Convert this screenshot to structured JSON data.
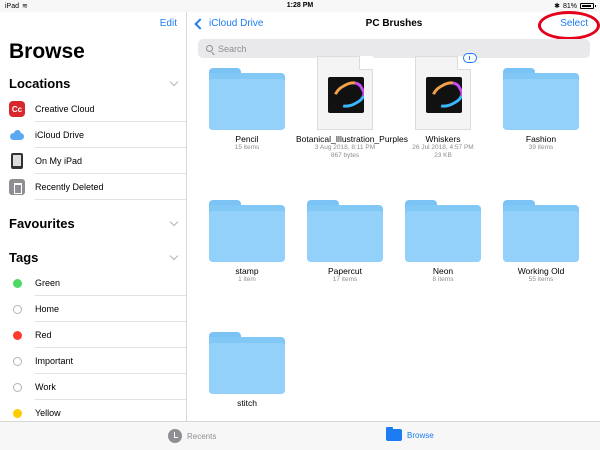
{
  "status": {
    "device": "iPad",
    "time": "1:28 PM",
    "battery": "81%"
  },
  "sidebar": {
    "edit_label": "Edit",
    "title": "Browse",
    "locations_header": "Locations",
    "locations": [
      {
        "label": "Creative Cloud",
        "icon": "creative-cloud-icon"
      },
      {
        "label": "iCloud Drive",
        "icon": "icloud-icon"
      },
      {
        "label": "On My iPad",
        "icon": "ipad-icon"
      },
      {
        "label": "Recently Deleted",
        "icon": "trash-icon"
      }
    ],
    "favourites_header": "Favourites",
    "tags_header": "Tags",
    "tags": [
      {
        "label": "Green",
        "color": "#4cd964"
      },
      {
        "label": "Home",
        "color": ""
      },
      {
        "label": "Red",
        "color": "#ff3b30"
      },
      {
        "label": "Important",
        "color": ""
      },
      {
        "label": "Work",
        "color": ""
      },
      {
        "label": "Yellow",
        "color": "#ffcc00"
      }
    ]
  },
  "nav": {
    "back_label": "iCloud Drive",
    "title": "PC Brushes",
    "select_label": "Select"
  },
  "search": {
    "placeholder": "Search"
  },
  "items": [
    {
      "type": "folder",
      "name": "Pencil",
      "meta1": "15 items",
      "meta2": ""
    },
    {
      "type": "doc",
      "name": "Botanical_Illustration_Purples",
      "meta1": "3 Aug 2018, 8:11 PM",
      "meta2": "867 bytes"
    },
    {
      "type": "doc",
      "name": "Whiskers",
      "meta1": "26 Jul 2018, 4:57 PM",
      "meta2": "23 KB"
    },
    {
      "type": "folder",
      "name": "Fashion",
      "meta1": "39 items",
      "meta2": ""
    },
    {
      "type": "folder",
      "name": "stamp",
      "meta1": "1 item",
      "meta2": ""
    },
    {
      "type": "folder",
      "name": "Papercut",
      "meta1": "17 items",
      "meta2": ""
    },
    {
      "type": "folder",
      "name": "Neon",
      "meta1": "8 items",
      "meta2": ""
    },
    {
      "type": "folder",
      "name": "Working Old",
      "meta1": "55 items",
      "meta2": ""
    },
    {
      "type": "folder",
      "name": "stitch",
      "meta1": "",
      "meta2": ""
    }
  ],
  "tabbar": {
    "recents_label": "Recents",
    "browse_label": "Browse"
  },
  "colors": {
    "accent": "#1e7cf2",
    "folder": "#93d1fa",
    "highlight_ring": "#e4001b"
  }
}
